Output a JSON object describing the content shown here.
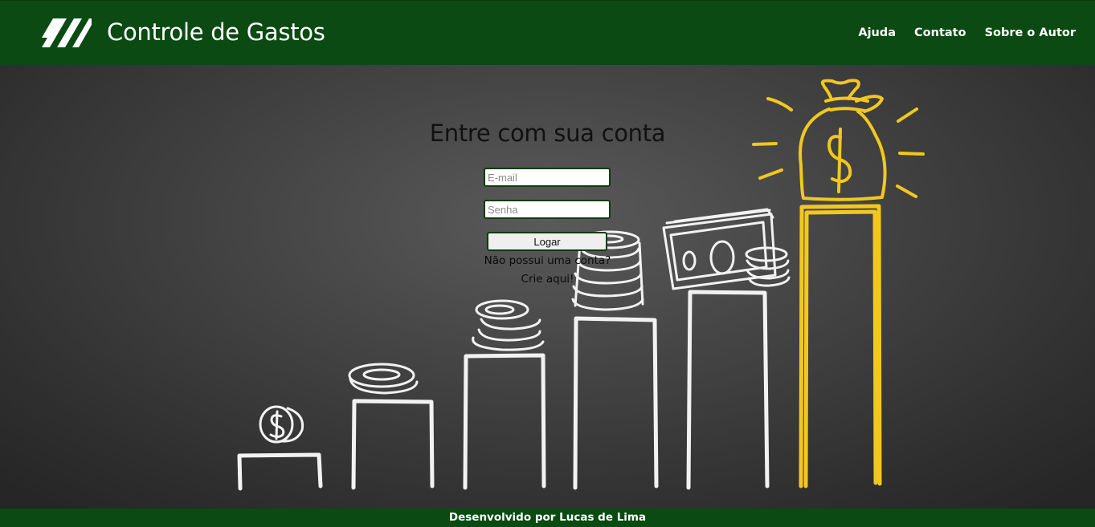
{
  "header": {
    "logo_icon": "stripes-logo-icon",
    "title": "Controle de Gastos",
    "nav": [
      {
        "label": "Ajuda"
      },
      {
        "label": "Contato"
      },
      {
        "label": "Sobre o Autor"
      }
    ]
  },
  "login": {
    "title": "Entre com sua conta",
    "email_placeholder": "E-mail",
    "password_placeholder": "Senha",
    "submit_label": "Logar",
    "signup_question": "Não possui uma conta?",
    "signup_link": "Crie aqui!"
  },
  "footer": {
    "text": "Desenvolvido por Lucas de Lima"
  },
  "colors": {
    "brand_green": "#0b4a12",
    "chalk_white": "#f2f2f2",
    "chalk_yellow": "#f2c81e",
    "background": "#3e3e3e"
  },
  "illustration": {
    "name": "chalk-drawing-growing-money-bars",
    "icons": [
      "coin-icon",
      "coin-stack-icon",
      "banknote-icon",
      "money-bag-icon"
    ]
  }
}
